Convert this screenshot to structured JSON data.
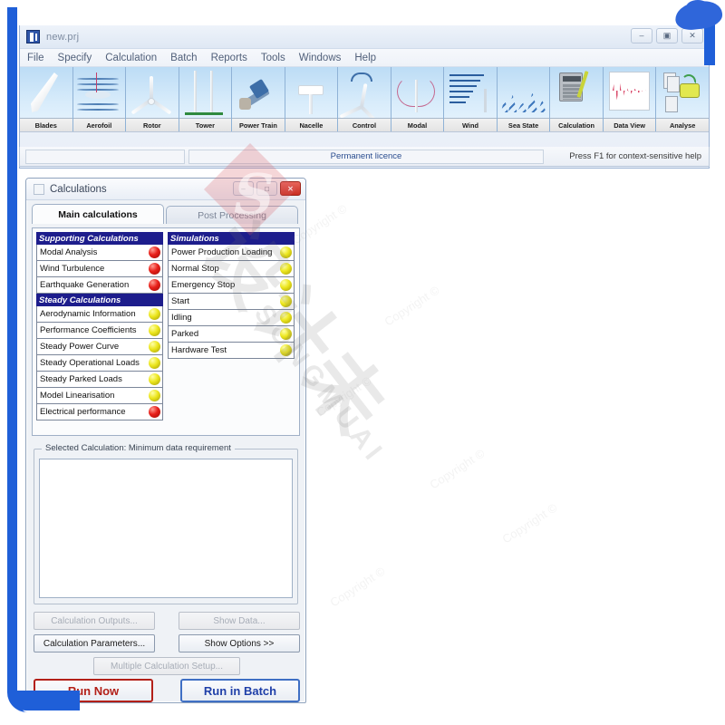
{
  "app": {
    "title": "new.prj",
    "icon": "app-logo-icon",
    "window_buttons": [
      {
        "name": "minimize",
        "glyph": "–"
      },
      {
        "name": "restore",
        "glyph": "▣"
      },
      {
        "name": "close",
        "glyph": "✕"
      }
    ],
    "menu": [
      "File",
      "Specify",
      "Calculation",
      "Batch",
      "Reports",
      "Tools",
      "Windows",
      "Help"
    ],
    "toolbar": [
      {
        "label": "Blades",
        "icon": "blade-icon"
      },
      {
        "label": "Aerofoil",
        "icon": "aerofoil-icon"
      },
      {
        "label": "Rotor",
        "icon": "rotor-icon"
      },
      {
        "label": "Tower",
        "icon": "tower-icon"
      },
      {
        "label": "Power Train",
        "icon": "power-train-icon"
      },
      {
        "label": "Nacelle",
        "icon": "nacelle-icon"
      },
      {
        "label": "Control",
        "icon": "control-icon"
      },
      {
        "label": "Modal",
        "icon": "modal-icon"
      },
      {
        "label": "Wind",
        "icon": "wind-icon"
      },
      {
        "label": "Sea State",
        "icon": "sea-state-icon"
      },
      {
        "label": "Calculation",
        "icon": "calculation-icon"
      },
      {
        "label": "Data View",
        "icon": "data-view-icon"
      },
      {
        "label": "Analyse",
        "icon": "analyse-icon"
      }
    ],
    "statusbar": {
      "left": "",
      "licence": "Permanent licence",
      "hint": "Press F1 for context-sensitive help"
    }
  },
  "dialog": {
    "title": "Calculations",
    "icon": "dialog-icon",
    "buttons": [
      {
        "name": "minimize",
        "glyph": "–"
      },
      {
        "name": "maximize",
        "glyph": "□"
      },
      {
        "name": "close",
        "glyph": "✕"
      }
    ],
    "tabs": [
      {
        "label": "Main calculations",
        "active": true
      },
      {
        "label": "Post Processing",
        "active": false
      }
    ],
    "left_list": [
      {
        "type": "header",
        "label": "Supporting Calculations"
      },
      {
        "type": "item",
        "label": "Modal Analysis",
        "lamp": "red"
      },
      {
        "type": "item",
        "label": "Wind Turbulence",
        "lamp": "red"
      },
      {
        "type": "item",
        "label": "Earthquake Generation",
        "lamp": "red"
      },
      {
        "type": "header",
        "label": "Steady Calculations"
      },
      {
        "type": "item",
        "label": "Aerodynamic Information",
        "lamp": "yellow"
      },
      {
        "type": "item",
        "label": "Performance Coefficients",
        "lamp": "yellow"
      },
      {
        "type": "item",
        "label": "Steady Power Curve",
        "lamp": "yellow"
      },
      {
        "type": "item",
        "label": "Steady Operational Loads",
        "lamp": "yellow"
      },
      {
        "type": "item",
        "label": "Steady Parked Loads",
        "lamp": "yellow"
      },
      {
        "type": "item",
        "label": "Model Linearisation",
        "lamp": "yellow"
      },
      {
        "type": "item",
        "label": "Electrical performance",
        "lamp": "red"
      }
    ],
    "right_list": [
      {
        "type": "header",
        "label": "Simulations"
      },
      {
        "type": "item",
        "label": "Power Production Loading",
        "lamp": "yellow"
      },
      {
        "type": "item",
        "label": "Normal Stop",
        "lamp": "yellow"
      },
      {
        "type": "item",
        "label": "Emergency Stop",
        "lamp": "yellow"
      },
      {
        "type": "item",
        "label": "Start",
        "lamp": "yellow"
      },
      {
        "type": "item",
        "label": "Idling",
        "lamp": "yellow"
      },
      {
        "type": "item",
        "label": "Parked",
        "lamp": "yellow"
      },
      {
        "type": "item",
        "label": "Hardware Test",
        "lamp": "yellow"
      }
    ],
    "groupbox": {
      "legend": "Selected Calculation: Minimum data requirement",
      "content": ""
    },
    "actions": {
      "calculation_outputs": "Calculation Outputs...",
      "show_data": "Show Data...",
      "calculation_parameters": "Calculation Parameters...",
      "show_options": "Show Options >>",
      "multiple_setup": "Multiple Calculation Setup...",
      "run_now": "Run Now",
      "run_in_batch": "Run in Batch"
    }
  },
  "watermark": {
    "main": "设计未",
    "brand": "SONGMUAI",
    "copyright": "Copyright ©",
    "logo_letter": "S"
  },
  "colors": {
    "header_blue": "#1d1d8c",
    "lamp_red": "#e8201a",
    "lamp_yellow": "#ece61d",
    "run_now_red": "#b32018",
    "run_batch_blue": "#1f3fa8",
    "marker_blue": "#1f5fd8"
  }
}
